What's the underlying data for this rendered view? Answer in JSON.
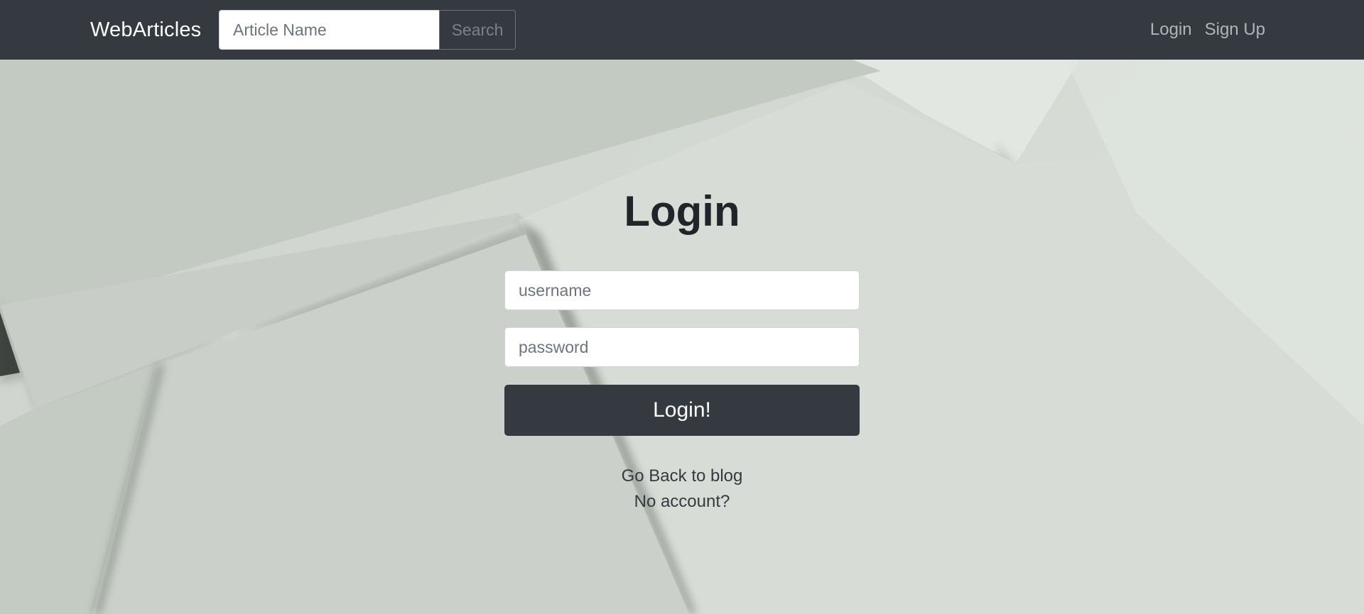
{
  "navbar": {
    "brand": "WebArticles",
    "search": {
      "placeholder": "Article Name",
      "value": "",
      "button_label": "Search"
    },
    "links": [
      {
        "label": "Login"
      },
      {
        "label": "Sign Up"
      }
    ],
    "background_color": "#343a40"
  },
  "login": {
    "title": "Login",
    "username": {
      "placeholder": "username",
      "value": ""
    },
    "password": {
      "placeholder": "password",
      "value": ""
    },
    "submit_label": "Login!",
    "back_link": "Go Back to blog",
    "signup_link": "No account?"
  },
  "colors": {
    "primary_dark": "#343a40",
    "text": "#212529",
    "background": "#cdd3cc"
  },
  "icons": {
    "background": "paper-sheets-image"
  }
}
